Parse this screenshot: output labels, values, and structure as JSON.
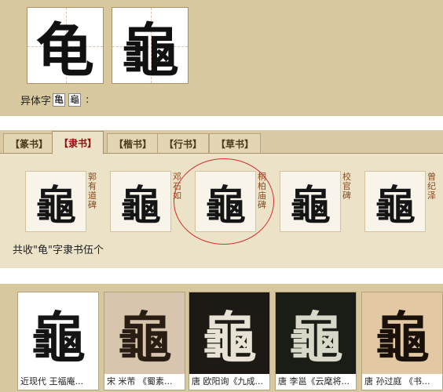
{
  "top": {
    "simplified_char": "龟",
    "traditional_char": "龜",
    "variant_label": "异体字",
    "variant_chars": [
      "亀",
      "龜"
    ],
    "variant_suffix": ":"
  },
  "tabs": [
    {
      "label": "【篆书】",
      "active": false
    },
    {
      "label": "【隶书】",
      "active": true
    },
    {
      "label": "【楷书】",
      "active": false
    },
    {
      "label": "【行书】",
      "active": false
    },
    {
      "label": "【草书】",
      "active": false
    }
  ],
  "lishu_cards": [
    {
      "char": "龜",
      "source": "郭有道碑"
    },
    {
      "char": "龜",
      "source": "邓石如"
    },
    {
      "char": "龜",
      "source": "桐柏庙碑"
    },
    {
      "char": "龜",
      "source": "校官碑"
    },
    {
      "char": "龜",
      "source": "曾纪泽"
    }
  ],
  "count_text": "共收\"龟\"字隶书伍个",
  "works": [
    {
      "char": "龜",
      "caption": "近现代 王福庵...",
      "bg": "#ffffff",
      "fg": "#151515"
    },
    {
      "char": "龜",
      "caption": "宋 米芾 《蜀素...",
      "bg": "#d7c6ad",
      "fg": "#2a1e14"
    },
    {
      "char": "龜",
      "caption": "唐 欧阳询《九成...",
      "bg": "#1d1a16",
      "fg": "#e8e2d4"
    },
    {
      "char": "龜",
      "caption": "唐 李邕《云麾将...",
      "bg": "#1a1c16",
      "fg": "#d8d8c8"
    },
    {
      "char": "龜",
      "caption": "唐 孙过庭 《书...",
      "bg": "#e2c9a3",
      "fg": "#1a120a"
    }
  ],
  "colors": {
    "accent_red": "#d03030",
    "source_text": "#8a4a20",
    "panel_tan": "#d8c8a0"
  }
}
